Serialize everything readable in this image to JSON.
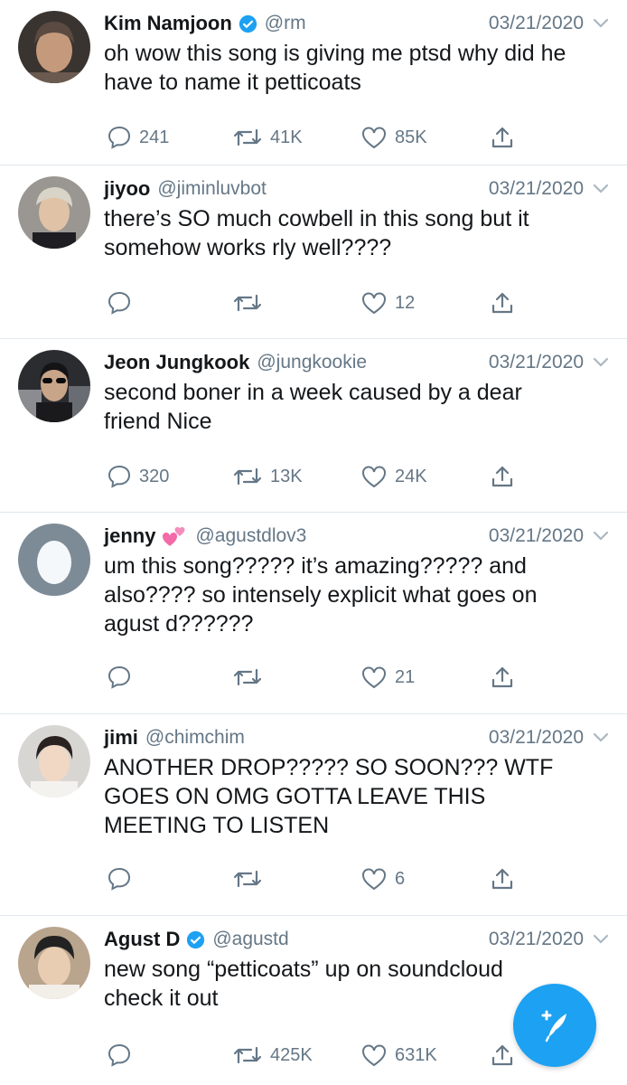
{
  "colors": {
    "accent": "#1da1f2",
    "text": "#14171a",
    "secondary": "#657786",
    "divider": "#e1e8ed"
  },
  "tweets": [
    {
      "name": "Kim Namjoon",
      "verified": true,
      "handle": "@rm",
      "date": "03/21/2020",
      "text": "oh wow this song is giving me ptsd why did he have to name it petticoats",
      "replies": "241",
      "retweets": "41K",
      "likes": "85K"
    },
    {
      "name": "jiyoo",
      "verified": false,
      "handle": "@jiminluvbot",
      "date": "03/21/2020",
      "text": "there’s SO much cowbell in this song but it somehow works rly well????",
      "replies": "",
      "retweets": "",
      "likes": "12"
    },
    {
      "name": "Jeon Jungkook",
      "verified": false,
      "handle": "@jungkookie",
      "date": "03/21/2020",
      "text": "second boner in a week caused by a dear friend Nice",
      "replies": "320",
      "retweets": "13K",
      "likes": "24K"
    },
    {
      "name": "jenny",
      "verified": false,
      "emoji": "two-hearts-emoji",
      "handle": "@agustdlov3",
      "date": "03/21/2020",
      "text": "um this song????? it’s amazing????? and also???? so intensely explicit what goes on agust d??????",
      "replies": "",
      "retweets": "",
      "likes": "21"
    },
    {
      "name": "jimi",
      "verified": false,
      "handle": "@chimchim",
      "date": "03/21/2020",
      "text": "ANOTHER DROP????? SO SOON??? WTF GOES ON OMG GOTTA LEAVE THIS MEETING TO LISTEN",
      "replies": "",
      "retweets": "",
      "likes": "6"
    },
    {
      "name": "Agust D",
      "verified": true,
      "handle": "@agustd",
      "date": "03/21/2020",
      "text": "new song “petticoats” up on soundcloud check it out",
      "replies": "",
      "retweets": "425K",
      "likes": "631K"
    }
  ],
  "icons": {
    "reply": "reply-icon",
    "retweet": "retweet-icon",
    "like": "heart-icon",
    "share": "share-icon",
    "verified": "verified-badge-icon",
    "chevron": "chevron-down-icon",
    "compose": "compose-tweet-icon"
  }
}
